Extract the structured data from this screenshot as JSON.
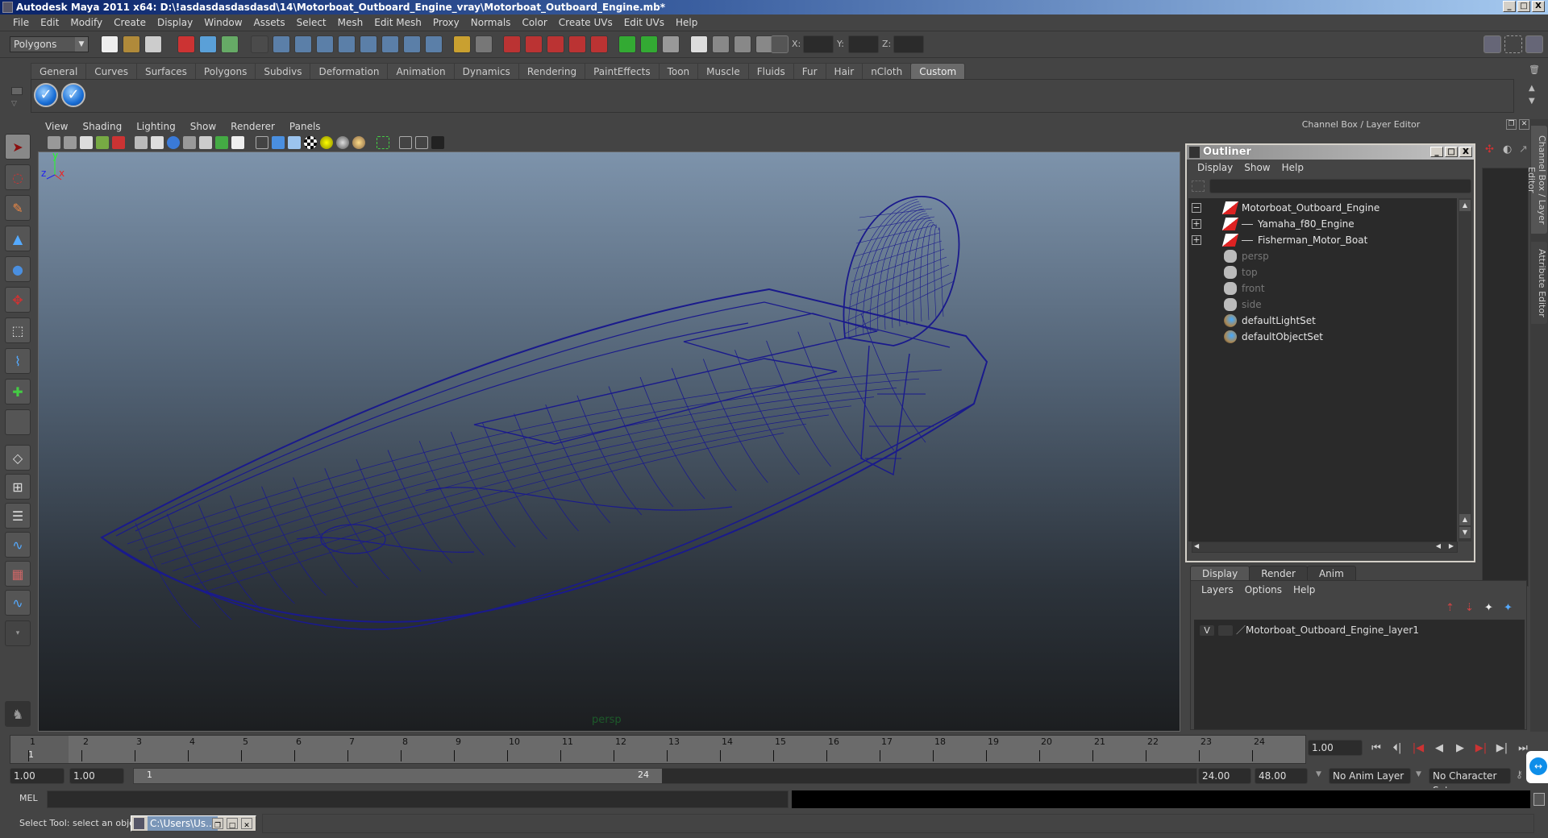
{
  "window": {
    "title": "Autodesk Maya 2011 x64: D:\\!asdasdasdasdasd\\14\\Motorboat_Outboard_Engine_vray\\Motorboat_Outboard_Engine.mb*",
    "controls": {
      "minimize": "_",
      "maximize": "□",
      "close": "X"
    }
  },
  "menubar": [
    "File",
    "Edit",
    "Modify",
    "Create",
    "Display",
    "Window",
    "Assets",
    "Select",
    "Mesh",
    "Edit Mesh",
    "Proxy",
    "Normals",
    "Color",
    "Create UVs",
    "Edit UVs",
    "Help"
  ],
  "statusline": {
    "mode": "Polygons",
    "coord_labels": {
      "x": "X:",
      "y": "Y:",
      "z": "Z:"
    },
    "coord_values": {
      "x": "",
      "y": "",
      "z": ""
    }
  },
  "shelf": {
    "tabs": [
      "General",
      "Curves",
      "Surfaces",
      "Polygons",
      "Subdivs",
      "Deformation",
      "Animation",
      "Dynamics",
      "Rendering",
      "PaintEffects",
      "Toon",
      "Muscle",
      "Fluids",
      "Fur",
      "Hair",
      "nCloth",
      "Custom"
    ],
    "active_tab": "Custom",
    "buttons": [
      "check-icon",
      "check-icon"
    ]
  },
  "tools": [
    "select-tool",
    "lasso-tool",
    "paint-select-tool",
    "move-tool",
    "rotate-tool",
    "scale-tool",
    "universal-manipulator",
    "soft-modification-tool",
    "show-manipulator",
    "last-tool-used"
  ],
  "layouts": [
    "single-perspective",
    "four-view",
    "outliner-perspective",
    "perspective-graph",
    "hypershade-perspective",
    "perspective-graph-hypergraph",
    "layout-more"
  ],
  "viewport": {
    "menu": [
      "View",
      "Shading",
      "Lighting",
      "Show",
      "Renderer",
      "Panels"
    ],
    "camera_label": "persp",
    "axis": {
      "x": "x",
      "y": "y",
      "z": "z"
    },
    "wire_color": "#1a1a8c"
  },
  "channel_box": {
    "header": "Channel Box / Layer Editor",
    "side_tabs": [
      "Channel Box / Layer Editor",
      "Attribute Editor"
    ]
  },
  "outliner": {
    "title": "Outliner",
    "menu": [
      "Display",
      "Show",
      "Help"
    ],
    "filter_value": "",
    "items": [
      {
        "label": "Motorboat_Outboard_Engine",
        "expand": "−",
        "type": "transform",
        "dim": false,
        "indent": 0
      },
      {
        "label": "Yamaha_f80_Engine",
        "expand": "+",
        "type": "transform",
        "dim": false,
        "indent": 1
      },
      {
        "label": "Fisherman_Motor_Boat",
        "expand": "+",
        "type": "transform",
        "dim": false,
        "indent": 1
      },
      {
        "label": "persp",
        "expand": "",
        "type": "camera",
        "dim": true,
        "indent": 0
      },
      {
        "label": "top",
        "expand": "",
        "type": "camera",
        "dim": true,
        "indent": 0
      },
      {
        "label": "front",
        "expand": "",
        "type": "camera",
        "dim": true,
        "indent": 0
      },
      {
        "label": "side",
        "expand": "",
        "type": "camera",
        "dim": true,
        "indent": 0
      },
      {
        "label": "defaultLightSet",
        "expand": "",
        "type": "set",
        "dim": false,
        "indent": 0
      },
      {
        "label": "defaultObjectSet",
        "expand": "",
        "type": "set",
        "dim": false,
        "indent": 0
      }
    ]
  },
  "layer_editor": {
    "tabs": [
      "Display",
      "Render",
      "Anim"
    ],
    "active_tab": "Display",
    "menu": [
      "Layers",
      "Options",
      "Help"
    ],
    "layers": [
      {
        "visible": "V",
        "name": "Motorboat_Outboard_Engine_layer1"
      }
    ]
  },
  "timeline": {
    "ticks": [
      "1",
      "2",
      "3",
      "4",
      "5",
      "6",
      "7",
      "8",
      "9",
      "10",
      "11",
      "12",
      "13",
      "14",
      "15",
      "16",
      "17",
      "18",
      "19",
      "20",
      "21",
      "22",
      "23",
      "24"
    ],
    "current_frame_marker": "1",
    "current_frame": "1.00",
    "playback_buttons": [
      "go-to-start",
      "step-back-key",
      "step-back-frame",
      "play-backwards",
      "play-forwards",
      "step-forward-frame",
      "step-forward-key",
      "go-to-end"
    ]
  },
  "range": {
    "start": "1.00",
    "anim_start": "1.00",
    "slider_start": "1",
    "slider_end": "24",
    "end": "24.00",
    "anim_end": "48.00",
    "anim_layer": "No Anim Layer",
    "character_set": "No Character Set"
  },
  "command_line": {
    "label": "MEL",
    "value": "",
    "result": ""
  },
  "status": {
    "help_line": "Select Tool: select an object",
    "task_window": "C:\\Users\\Us..."
  }
}
